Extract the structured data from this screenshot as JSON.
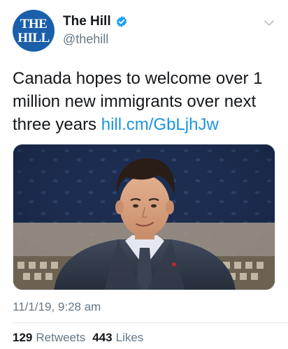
{
  "header": {
    "avatar_line1": "THE",
    "avatar_line2": "HILL",
    "display_name": "The Hill",
    "handle": "@thehill",
    "verified": true
  },
  "tweet": {
    "text": "Canada hopes to welcome over 1 million new immigrants over next three years ",
    "link": "hill.cm/GbLjhJw"
  },
  "timestamp": "11/1/19, 9:28 am",
  "stats": {
    "retweets_count": "129",
    "retweets_label": "Retweets",
    "likes_count": "443",
    "likes_label": "Likes"
  },
  "colors": {
    "brand_blue": "#1b5faa",
    "link_blue": "#1b95e0",
    "verified_blue": "#1da1f2",
    "muted": "#657786"
  },
  "icons": {
    "verified": "verified-badge-icon",
    "menu": "chevron-down-icon"
  }
}
